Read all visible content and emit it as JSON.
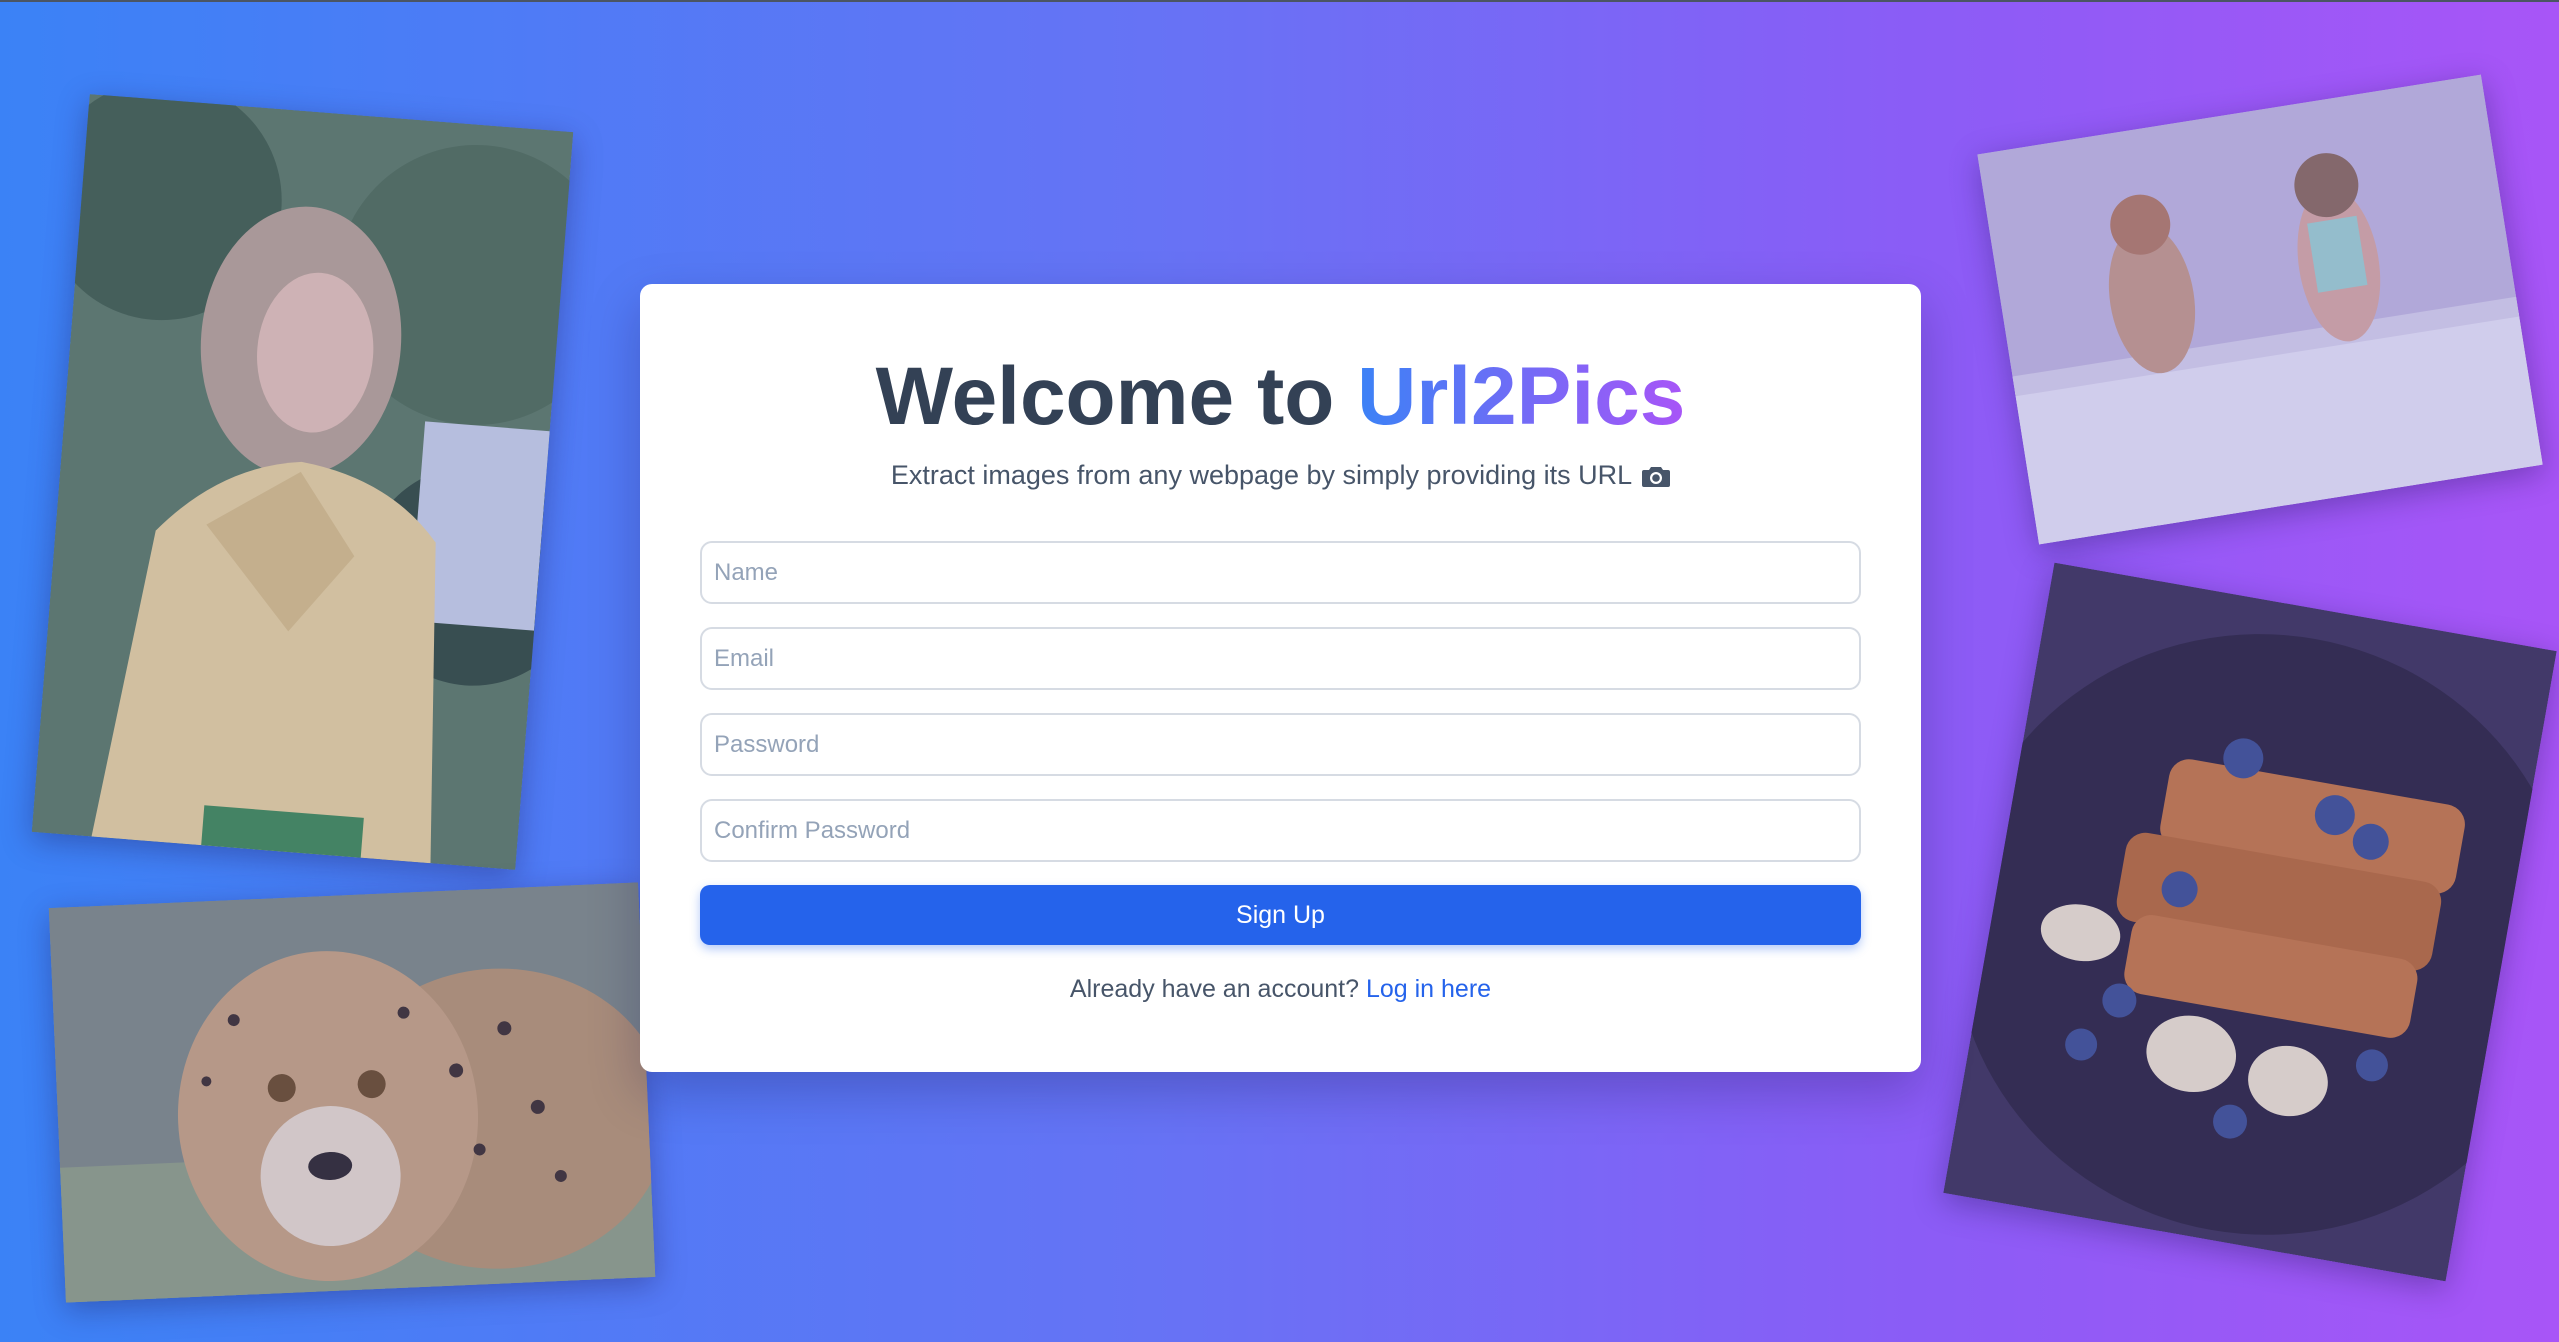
{
  "header": {
    "title_prefix": "Welcome to",
    "title_brand": "Url2Pics",
    "subtitle": "Extract images from any webpage by simply providing its URL",
    "subtitle_icon": "camera-icon"
  },
  "form": {
    "name_placeholder": "Name",
    "email_placeholder": "Email",
    "password_placeholder": "Password",
    "confirm_password_placeholder": "Confirm Password",
    "submit_label": "Sign Up"
  },
  "footer": {
    "prompt": "Already have an account?",
    "link_label": "Log in here"
  },
  "colors": {
    "gradient_start": "#3b82f6",
    "gradient_end": "#a855f7",
    "primary_button": "#2563eb",
    "heading": "#334155"
  },
  "photos": [
    "woman-in-yellow-blazer",
    "cheetah",
    "children-sitting",
    "french-toast-blueberries"
  ]
}
